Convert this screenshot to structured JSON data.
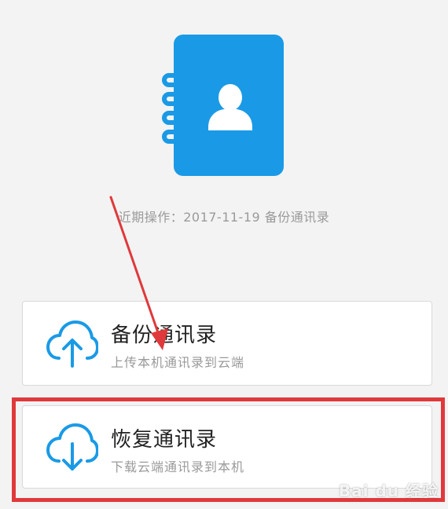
{
  "recent_operation": "近期操作：2017-11-19 备份通讯录",
  "cards": [
    {
      "title": "备份通讯录",
      "subtitle": "上传本机通讯录到云端",
      "icon": "cloud-upload-icon"
    },
    {
      "title": "恢复通讯录",
      "subtitle": "下载云端通讯录到本机",
      "icon": "cloud-download-icon"
    }
  ],
  "hero_icon": "contact-book-icon",
  "watermark": "Bai du 经验",
  "colors": {
    "accent_blue": "#1a9ae6",
    "highlight_red": "#e0393b",
    "background": "#f3f3f3"
  }
}
